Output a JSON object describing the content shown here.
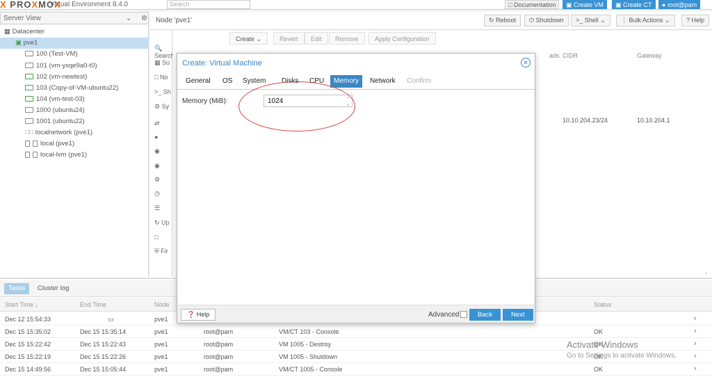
{
  "header": {
    "product_version": "Virtual Environment 8.4.0",
    "search_placeholder": "Search",
    "documentation": "Documentation",
    "create_vm": "Create VM",
    "create_ct": "Create CT",
    "user": "root@pam"
  },
  "sidebar": {
    "view_label": "Server View",
    "items": [
      {
        "label": "Datacenter"
      },
      {
        "label": "pve1"
      },
      {
        "label": "100 (Test-VM)"
      },
      {
        "label": "101 (vm-yxqe9a0-t0)"
      },
      {
        "label": "102 (vm-newtest)"
      },
      {
        "label": "103 (Copy-of-VM-ubuntu22)"
      },
      {
        "label": "104 (vm-test-03)"
      },
      {
        "label": "1000 (ubuntu24)"
      },
      {
        "label": "1001 (ubuntu22)"
      },
      {
        "label": "localnetwork (pve1)"
      },
      {
        "label": "local (pve1)"
      },
      {
        "label": "local-lvm (pve1)"
      }
    ]
  },
  "node": {
    "title": "Node 'pve1'",
    "reboot": "Reboot",
    "shutdown": "Shutdown",
    "shell": "Shell",
    "bulk_actions": "Bulk Actions",
    "help": "Help",
    "side_items": [
      "Search",
      "Su",
      "No",
      "Sh",
      "Sy",
      "Up",
      "Fir"
    ],
    "toolbar": [
      "Create",
      "Revert",
      "Edit",
      "Remove",
      "Apply Configuration"
    ],
    "grid_headers": [
      "ads",
      "CIDR",
      "Gateway"
    ],
    "grid_row": {
      "cidr": "10.10.204.23/24",
      "gateway": "10.10.204.1"
    }
  },
  "tasks": {
    "tabs": [
      "Tasks",
      "Cluster log"
    ],
    "headers": [
      "Start Time",
      "End Time",
      "Node",
      "Status"
    ],
    "rows": [
      {
        "start": "Dec 12 15:54:33",
        "end": "",
        "node": "pve1",
        "user": "",
        "desc": "",
        "status": ""
      },
      {
        "start": "Dec 15 15:35:02",
        "end": "Dec 15 15:35:14",
        "node": "pve1",
        "user": "root@pam",
        "desc": "VM/CT 103 - Console",
        "status": "OK"
      },
      {
        "start": "Dec 15 15:22:42",
        "end": "Dec 15 15:22:43",
        "node": "pve1",
        "user": "root@pam",
        "desc": "VM 1005 - Destroy",
        "status": "OK"
      },
      {
        "start": "Dec 15 15:22:19",
        "end": "Dec 15 15:22:26",
        "node": "pve1",
        "user": "root@pam",
        "desc": "VM 1005 - Shutdown",
        "status": "OK"
      },
      {
        "start": "Dec 15 14:49:56",
        "end": "Dec 15 15:05:44",
        "node": "pve1",
        "user": "root@pam",
        "desc": "VM/CT 1005 - Console",
        "status": "OK"
      }
    ]
  },
  "modal": {
    "title": "Create: Virtual Machine",
    "tabs": [
      "General",
      "OS",
      "System",
      "Disks",
      "CPU",
      "Memory",
      "Network",
      "Confirm"
    ],
    "active_tab": "Memory",
    "memory_label": "Memory (MiB):",
    "memory_value": "1024",
    "help": "Help",
    "advanced": "Advanced",
    "back": "Back",
    "next": "Next"
  },
  "watermark": {
    "line1": "Activate Windows",
    "line2": "Go to Settings to activate Windows."
  },
  "colors": {
    "accent": "#3892d4",
    "annotation": "#d23a3a"
  }
}
